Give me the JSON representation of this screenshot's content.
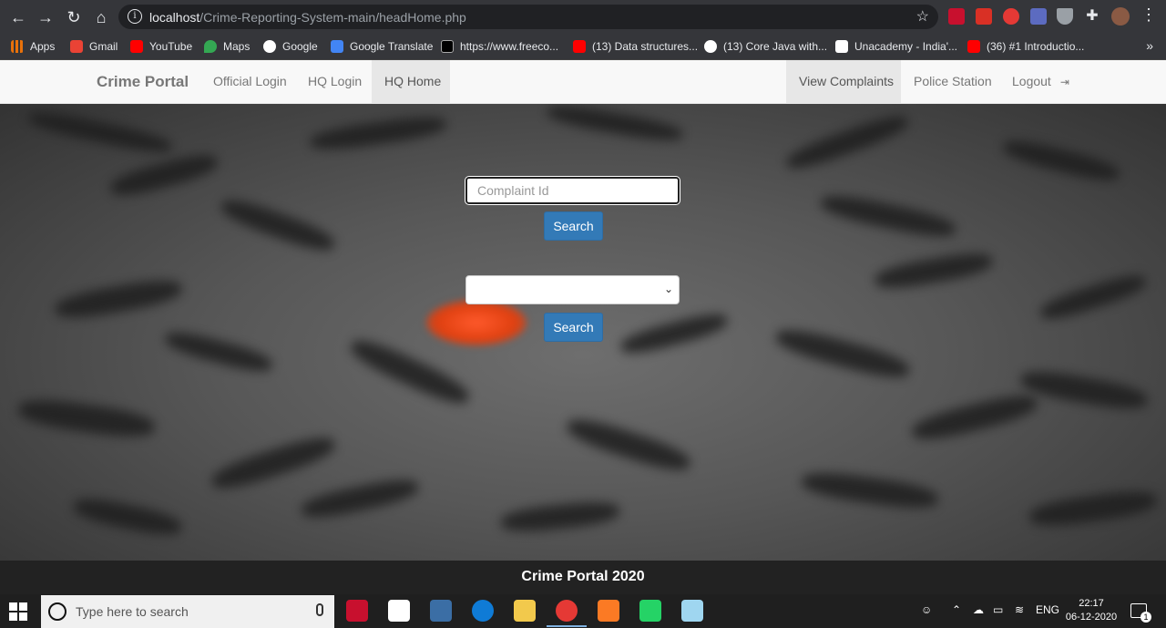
{
  "browser": {
    "url_host": "localhost",
    "url_path": "/Crime-Reporting-System-main/headHome.php"
  },
  "bookmarks": [
    {
      "label": "Apps",
      "icon": "apps-grid-icon",
      "color": "#e8710a"
    },
    {
      "label": "Gmail",
      "icon": "gmail-icon",
      "color": "#ea4335"
    },
    {
      "label": "YouTube",
      "icon": "youtube-icon",
      "color": "#ff0000"
    },
    {
      "label": "Maps",
      "icon": "maps-icon",
      "color": "#34a853"
    },
    {
      "label": "Google",
      "icon": "google-icon",
      "color": "#ffffff"
    },
    {
      "label": "Google Translate",
      "icon": "translate-icon",
      "color": "#4285f4"
    },
    {
      "label": "https://www.freeco...",
      "icon": "freecodecamp-icon",
      "color": "#000000"
    },
    {
      "label": "(13) Data structures...",
      "icon": "youtube-icon",
      "color": "#ff0000"
    },
    {
      "label": "(13) Core Java with...",
      "icon": "globe-icon",
      "color": "#ffffff"
    },
    {
      "label": "Unacademy - India'...",
      "icon": "unacademy-icon",
      "color": "#ffffff"
    },
    {
      "label": "(36) #1 Introductio...",
      "icon": "youtube-icon",
      "color": "#ff0000"
    }
  ],
  "navbar": {
    "brand": "Crime Portal",
    "links_left": [
      "Official Login",
      "HQ Login",
      "HQ Home"
    ],
    "links_right": [
      "View Complaints",
      "Police Station",
      "Logout"
    ],
    "active_left": "HQ Home",
    "active_right": "View Complaints"
  },
  "search": {
    "complaint_placeholder": "Complaint Id",
    "search_label_1": "Search",
    "station_selected": "",
    "search_label_2": "Search"
  },
  "footer": {
    "text": "Crime Portal 2020"
  },
  "taskbar": {
    "search_placeholder": "Type here to search",
    "language": "ENG",
    "time": "22:17",
    "date": "06-12-2020",
    "notification_count": "1"
  },
  "colors": {
    "primary_button": "#337ab7",
    "navbar_bg": "#f8f8f8",
    "footer_bg": "#222222"
  }
}
